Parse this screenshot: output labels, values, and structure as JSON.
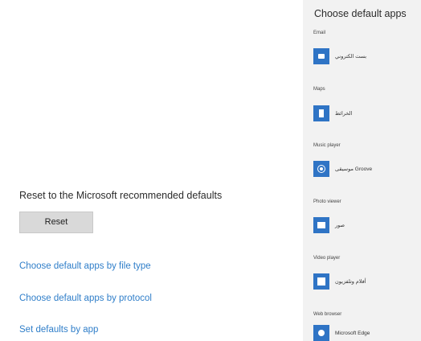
{
  "left_panel": {
    "reset_title": "Reset to the Microsoft recommended defaults",
    "reset_button_label": "Reset",
    "links": [
      "Choose default apps by file type",
      "Choose default apps by protocol",
      "Set defaults by app"
    ]
  },
  "right_panel": {
    "title": "Choose default apps",
    "sections": [
      {
        "category": "Email",
        "app": "بست الكتروني",
        "icon": "mail-icon"
      },
      {
        "category": "Maps",
        "app": "الخرائط",
        "icon": "map-icon"
      },
      {
        "category": "Music player",
        "app": "موسيقى Groove",
        "icon": "music-icon"
      },
      {
        "category": "Photo viewer",
        "app": "صور",
        "icon": "photo-icon"
      },
      {
        "category": "Video player",
        "app": "أفلام وتلفزيون",
        "icon": "video-icon"
      },
      {
        "category": "Web browser",
        "app": "Microsoft Edge",
        "icon": "edge-icon"
      }
    ]
  },
  "colors": {
    "link": "#2f7ec9",
    "accent_tile": "#2f74c5",
    "panel_bg": "#f2f2f2",
    "button_bg": "#d9d9d9"
  }
}
